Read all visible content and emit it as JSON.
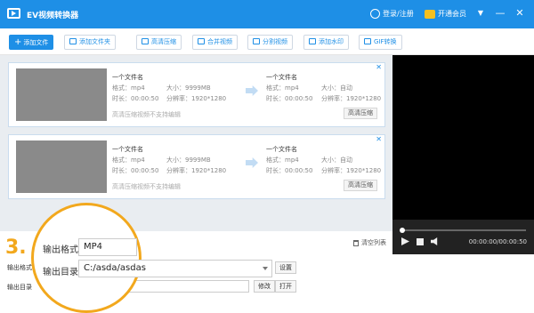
{
  "app": {
    "title": "EV视频转换器",
    "login": "登录/注册",
    "vip": "开通会员",
    "win_menu": "▼",
    "win_min": "—",
    "win_close": "✕"
  },
  "toolbar": {
    "add_file": "添加文件",
    "add_folder": "添加文件夹",
    "hd_compress": "高清压缩",
    "merge": "合并视频",
    "split": "分割视频",
    "watermark": "添加水印",
    "gif": "GIF转换"
  },
  "files": [
    {
      "name": "一个文件名",
      "format": "格式：mp4",
      "size": "大小：9999MB",
      "duration": "时长：00:00:50",
      "resolution": "分辨率：1920*1280",
      "out_name": "一个文件名",
      "out_format": "格式：mp4",
      "out_size": "大小：自动",
      "out_duration": "时长：00:00:50",
      "out_resolution": "分辨率：1920*1280",
      "note": "高清压缩视频不支持编辑",
      "button": "高清压缩",
      "close": "✕"
    },
    {
      "name": "一个文件名",
      "format": "格式：mp4",
      "size": "大小：9999MB",
      "duration": "时长：00:00:50",
      "resolution": "分辨率：1920*1280",
      "out_name": "一个文件名",
      "out_format": "格式：mp4",
      "out_size": "大小：自动",
      "out_duration": "时长：00:00:50",
      "out_resolution": "分辨率：1920*1280",
      "note": "高清压缩视频不支持编辑",
      "button": "高清压缩",
      "close": "✕"
    }
  ],
  "clear_list": "清空列表",
  "player": {
    "time": "00:00:00/00:00:50",
    "progress": 0
  },
  "output": {
    "format_label": "输出格式",
    "dir_label": "输出目录",
    "format_value": "MP4",
    "dir_value": "C:/asda/asdas",
    "settings": "设置",
    "modify": "修改",
    "open": "打开"
  },
  "step_marker": "3.",
  "colors": {
    "accent": "#1e8fe6",
    "highlight": "#f2a81d"
  }
}
